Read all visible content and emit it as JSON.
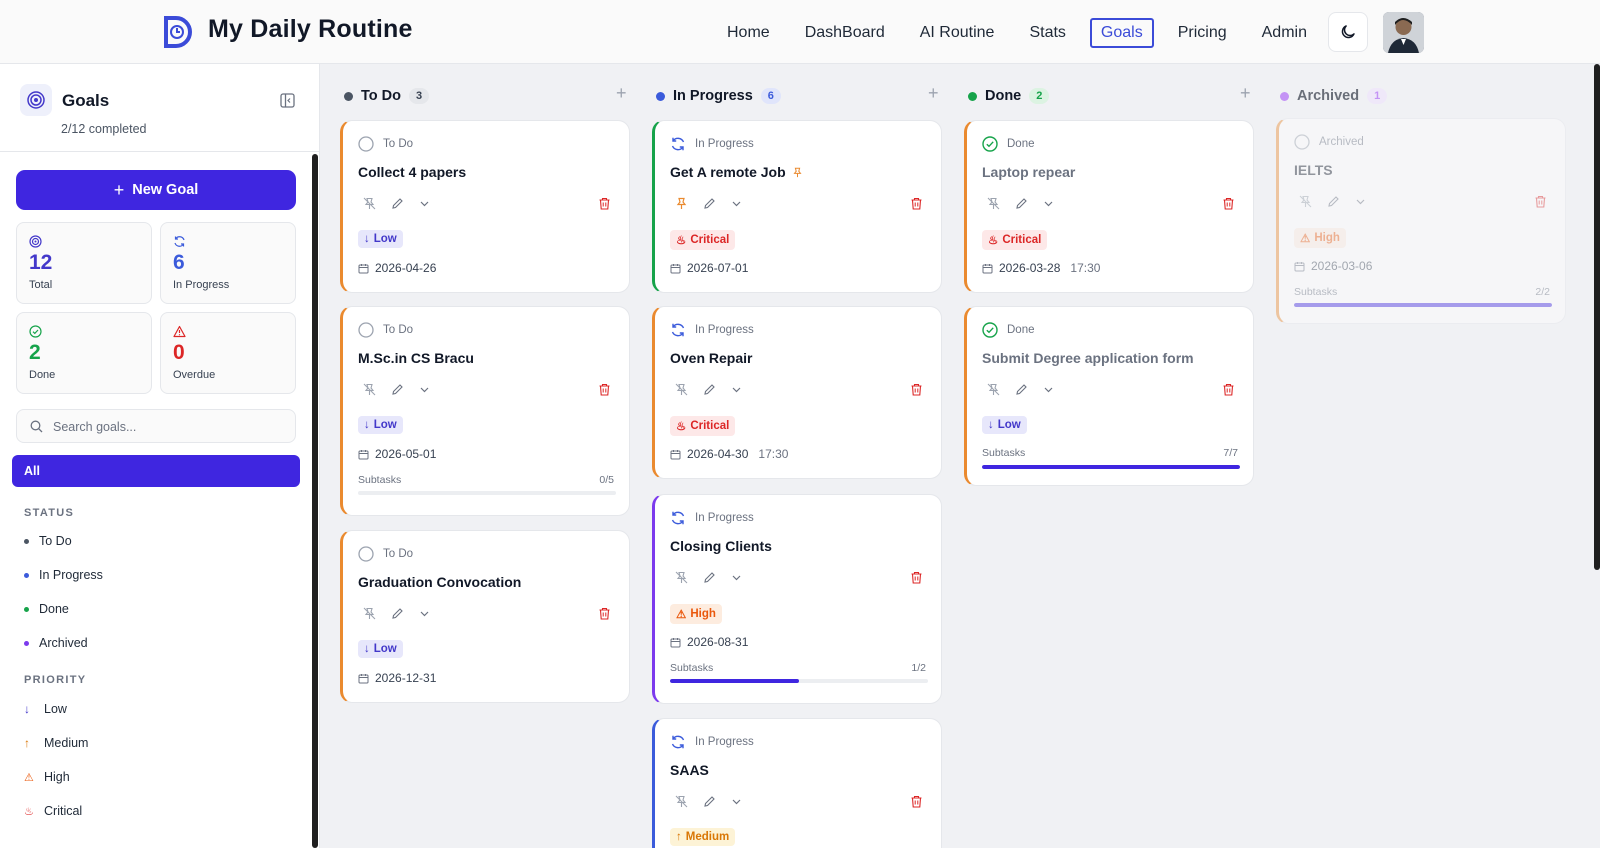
{
  "app": {
    "title": "My Daily Routine"
  },
  "nav": {
    "items": [
      "Home",
      "DashBoard",
      "AI Routine",
      "Stats",
      "Goals",
      "Pricing",
      "Admin"
    ],
    "active": "Goals"
  },
  "sidebar": {
    "title": "Goals",
    "subtitle": "2/12 completed",
    "new_goal_label": "New Goal",
    "stats": [
      {
        "value": "12",
        "label": "Total",
        "color": "#4338ca",
        "icon": "target-icon"
      },
      {
        "value": "6",
        "label": "In Progress",
        "color": "#3b5bdb",
        "icon": "refresh-icon"
      },
      {
        "value": "2",
        "label": "Done",
        "color": "#16a34a",
        "icon": "check-circle-icon"
      },
      {
        "value": "0",
        "label": "Overdue",
        "color": "#dc2626",
        "icon": "alert-triangle-icon"
      }
    ],
    "search_placeholder": "Search goals...",
    "filter_all": "All",
    "status_title": "STATUS",
    "statuses": [
      {
        "label": "To Do",
        "color": "#4b5563"
      },
      {
        "label": "In Progress",
        "color": "#3b5bdb"
      },
      {
        "label": "Done",
        "color": "#16a34a"
      },
      {
        "label": "Archived",
        "color": "#7c3aed"
      }
    ],
    "priority_title": "PRIORITY",
    "priorities": [
      {
        "label": "Low",
        "color": "#4338ca",
        "icon": "arrow-down-icon"
      },
      {
        "label": "Medium",
        "color": "#d97706",
        "icon": "arrow-up-icon"
      },
      {
        "label": "High",
        "color": "#ea580c",
        "icon": "alert-triangle-icon"
      },
      {
        "label": "Critical",
        "color": "#dc2626",
        "icon": "flame-icon"
      }
    ]
  },
  "columns": [
    {
      "name": "To Do",
      "count": "3",
      "color": "#4b5563",
      "count_bg": "#e5e7eb",
      "count_color": "#374151"
    },
    {
      "name": "In Progress",
      "count": "6",
      "color": "#3b5bdb",
      "count_bg": "#e0e5fb",
      "count_color": "#3b5bdb"
    },
    {
      "name": "Done",
      "count": "2",
      "color": "#16a34a",
      "count_bg": "#dcf3e2",
      "count_color": "#16a34a"
    },
    {
      "name": "Archived",
      "count": "1",
      "color": "#a855f7",
      "count_bg": "#efe3fd",
      "count_color": "#a855f7"
    }
  ],
  "cards": {
    "c1": {
      "status": "To Do",
      "title": "Collect 4 papers",
      "priority": "Low",
      "date": "2026-04-26"
    },
    "c2": {
      "status": "To Do",
      "title": "M.Sc.in CS Bracu",
      "priority": "Low",
      "date": "2026-05-01",
      "subtasks_label": "Subtasks",
      "subtasks": "0/5",
      "progress": 0
    },
    "c3": {
      "status": "To Do",
      "title": "Graduation Convocation",
      "priority": "Low",
      "date": "2026-12-31"
    },
    "c4": {
      "status": "In Progress",
      "title": "Get A remote Job",
      "priority": "Critical",
      "date": "2026-07-01",
      "pinned": true
    },
    "c5": {
      "status": "In Progress",
      "title": "Oven Repair",
      "priority": "Critical",
      "date": "2026-04-30",
      "time": "17:30"
    },
    "c6": {
      "status": "In Progress",
      "title": "Closing Clients",
      "priority": "High",
      "date": "2026-08-31",
      "subtasks_label": "Subtasks",
      "subtasks": "1/2",
      "progress": 0.5
    },
    "c7": {
      "status": "In Progress",
      "title": "SAAS",
      "priority": "Medium"
    },
    "c8": {
      "status": "Done",
      "title": "Laptop repear",
      "priority": "Critical",
      "date": "2026-03-28",
      "time": "17:30"
    },
    "c9": {
      "status": "Done",
      "title": "Submit Degree application form",
      "priority": "Low",
      "subtasks_label": "Subtasks",
      "subtasks": "7/7",
      "progress": 1
    },
    "c10": {
      "status": "Archived",
      "title": "IELTS",
      "priority": "High",
      "date": "2026-03-06",
      "subtasks_label": "Subtasks",
      "subtasks": "2/2",
      "progress": 1
    }
  },
  "colors": {
    "accent": "#3f26e0",
    "border_orange": "#ea8a2f",
    "border_green": "#16a34a",
    "border_purple": "#7c3aed",
    "border_blue": "#3b5bdb"
  }
}
